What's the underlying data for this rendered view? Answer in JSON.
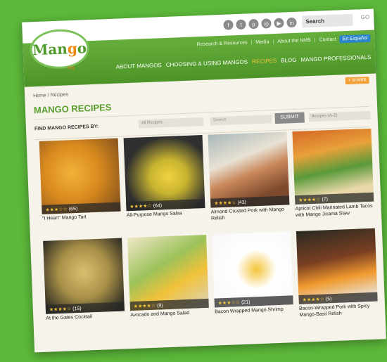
{
  "topbar": {
    "social_icons": [
      "facebook-icon",
      "twitter-icon",
      "pinterest-icon",
      "instagram-icon",
      "youtube-icon",
      "linkedin-icon"
    ],
    "search_label": "Search",
    "go_label": "GO"
  },
  "logo": {
    "text_a": "Man",
    "text_g": "g",
    "text_o": "o",
    "sub": ".org"
  },
  "utility_nav": {
    "research": "Research & Resources",
    "media": "Media",
    "about": "About the NMB",
    "contact": "Contact",
    "espanol": "En Español"
  },
  "main_nav": [
    "ABOUT MANGOS",
    "CHOOSING & USING MANGOS",
    "RECIPES",
    "BLOG",
    "MANGO PROFESSIONALS"
  ],
  "breadcrumb": "Home / Recipes",
  "share_label": "+ SHARE",
  "page_title": "MANGO RECIPES",
  "filter": {
    "label": "FIND MANGO RECIPES BY:",
    "select1": "All Recipes",
    "search_placeholder": "Search",
    "submit": "SUBMIT",
    "select2": "Recipes (A-Z)"
  },
  "recipes": [
    {
      "title": "\"I Heart\" Mango Tart",
      "stars": "★★★☆☆",
      "count": "(65)"
    },
    {
      "title": "All-Purpose Mango Salsa",
      "stars": "★★★★☆",
      "count": "(64)"
    },
    {
      "title": "Almond Crusted Pork with Mango Relish",
      "stars": "★★★★☆",
      "count": "(43)"
    },
    {
      "title": "Apricot Chili Marinated Lamb Tacos with Mango Jicama Slaw",
      "stars": "★★★★☆",
      "count": "(7)"
    },
    {
      "title": "At the Gates Cocktail",
      "stars": "★★★★☆",
      "count": "(15)"
    },
    {
      "title": "Avocado and Mango Salad",
      "stars": "★★★★☆",
      "count": "(9)"
    },
    {
      "title": "Bacon Wrapped Mango Shrimp",
      "stars": "★★★☆☆",
      "count": "(21)"
    },
    {
      "title": "Bacon-Wrapped Pork with Spicy Mango-Basil Relish",
      "stars": "★★★★☆",
      "count": "(5)"
    }
  ]
}
